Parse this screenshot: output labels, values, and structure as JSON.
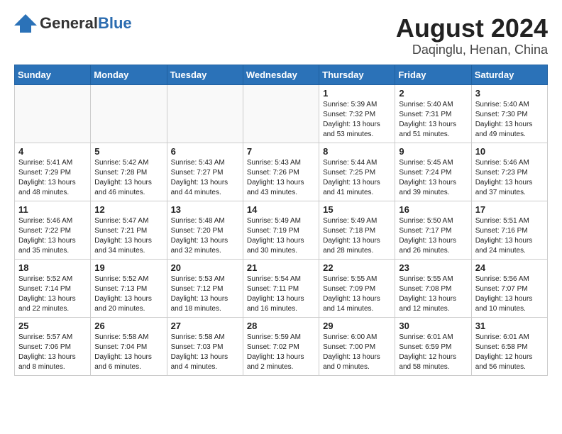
{
  "header": {
    "logo_general": "General",
    "logo_blue": "Blue",
    "month_title": "August 2024",
    "location": "Daqinglu, Henan, China"
  },
  "weekdays": [
    "Sunday",
    "Monday",
    "Tuesday",
    "Wednesday",
    "Thursday",
    "Friday",
    "Saturday"
  ],
  "weeks": [
    [
      {
        "day": "",
        "info": ""
      },
      {
        "day": "",
        "info": ""
      },
      {
        "day": "",
        "info": ""
      },
      {
        "day": "",
        "info": ""
      },
      {
        "day": "1",
        "info": "Sunrise: 5:39 AM\nSunset: 7:32 PM\nDaylight: 13 hours\nand 53 minutes."
      },
      {
        "day": "2",
        "info": "Sunrise: 5:40 AM\nSunset: 7:31 PM\nDaylight: 13 hours\nand 51 minutes."
      },
      {
        "day": "3",
        "info": "Sunrise: 5:40 AM\nSunset: 7:30 PM\nDaylight: 13 hours\nand 49 minutes."
      }
    ],
    [
      {
        "day": "4",
        "info": "Sunrise: 5:41 AM\nSunset: 7:29 PM\nDaylight: 13 hours\nand 48 minutes."
      },
      {
        "day": "5",
        "info": "Sunrise: 5:42 AM\nSunset: 7:28 PM\nDaylight: 13 hours\nand 46 minutes."
      },
      {
        "day": "6",
        "info": "Sunrise: 5:43 AM\nSunset: 7:27 PM\nDaylight: 13 hours\nand 44 minutes."
      },
      {
        "day": "7",
        "info": "Sunrise: 5:43 AM\nSunset: 7:26 PM\nDaylight: 13 hours\nand 43 minutes."
      },
      {
        "day": "8",
        "info": "Sunrise: 5:44 AM\nSunset: 7:25 PM\nDaylight: 13 hours\nand 41 minutes."
      },
      {
        "day": "9",
        "info": "Sunrise: 5:45 AM\nSunset: 7:24 PM\nDaylight: 13 hours\nand 39 minutes."
      },
      {
        "day": "10",
        "info": "Sunrise: 5:46 AM\nSunset: 7:23 PM\nDaylight: 13 hours\nand 37 minutes."
      }
    ],
    [
      {
        "day": "11",
        "info": "Sunrise: 5:46 AM\nSunset: 7:22 PM\nDaylight: 13 hours\nand 35 minutes."
      },
      {
        "day": "12",
        "info": "Sunrise: 5:47 AM\nSunset: 7:21 PM\nDaylight: 13 hours\nand 34 minutes."
      },
      {
        "day": "13",
        "info": "Sunrise: 5:48 AM\nSunset: 7:20 PM\nDaylight: 13 hours\nand 32 minutes."
      },
      {
        "day": "14",
        "info": "Sunrise: 5:49 AM\nSunset: 7:19 PM\nDaylight: 13 hours\nand 30 minutes."
      },
      {
        "day": "15",
        "info": "Sunrise: 5:49 AM\nSunset: 7:18 PM\nDaylight: 13 hours\nand 28 minutes."
      },
      {
        "day": "16",
        "info": "Sunrise: 5:50 AM\nSunset: 7:17 PM\nDaylight: 13 hours\nand 26 minutes."
      },
      {
        "day": "17",
        "info": "Sunrise: 5:51 AM\nSunset: 7:16 PM\nDaylight: 13 hours\nand 24 minutes."
      }
    ],
    [
      {
        "day": "18",
        "info": "Sunrise: 5:52 AM\nSunset: 7:14 PM\nDaylight: 13 hours\nand 22 minutes."
      },
      {
        "day": "19",
        "info": "Sunrise: 5:52 AM\nSunset: 7:13 PM\nDaylight: 13 hours\nand 20 minutes."
      },
      {
        "day": "20",
        "info": "Sunrise: 5:53 AM\nSunset: 7:12 PM\nDaylight: 13 hours\nand 18 minutes."
      },
      {
        "day": "21",
        "info": "Sunrise: 5:54 AM\nSunset: 7:11 PM\nDaylight: 13 hours\nand 16 minutes."
      },
      {
        "day": "22",
        "info": "Sunrise: 5:55 AM\nSunset: 7:09 PM\nDaylight: 13 hours\nand 14 minutes."
      },
      {
        "day": "23",
        "info": "Sunrise: 5:55 AM\nSunset: 7:08 PM\nDaylight: 13 hours\nand 12 minutes."
      },
      {
        "day": "24",
        "info": "Sunrise: 5:56 AM\nSunset: 7:07 PM\nDaylight: 13 hours\nand 10 minutes."
      }
    ],
    [
      {
        "day": "25",
        "info": "Sunrise: 5:57 AM\nSunset: 7:06 PM\nDaylight: 13 hours\nand 8 minutes."
      },
      {
        "day": "26",
        "info": "Sunrise: 5:58 AM\nSunset: 7:04 PM\nDaylight: 13 hours\nand 6 minutes."
      },
      {
        "day": "27",
        "info": "Sunrise: 5:58 AM\nSunset: 7:03 PM\nDaylight: 13 hours\nand 4 minutes."
      },
      {
        "day": "28",
        "info": "Sunrise: 5:59 AM\nSunset: 7:02 PM\nDaylight: 13 hours\nand 2 minutes."
      },
      {
        "day": "29",
        "info": "Sunrise: 6:00 AM\nSunset: 7:00 PM\nDaylight: 13 hours\nand 0 minutes."
      },
      {
        "day": "30",
        "info": "Sunrise: 6:01 AM\nSunset: 6:59 PM\nDaylight: 12 hours\nand 58 minutes."
      },
      {
        "day": "31",
        "info": "Sunrise: 6:01 AM\nSunset: 6:58 PM\nDaylight: 12 hours\nand 56 minutes."
      }
    ]
  ]
}
